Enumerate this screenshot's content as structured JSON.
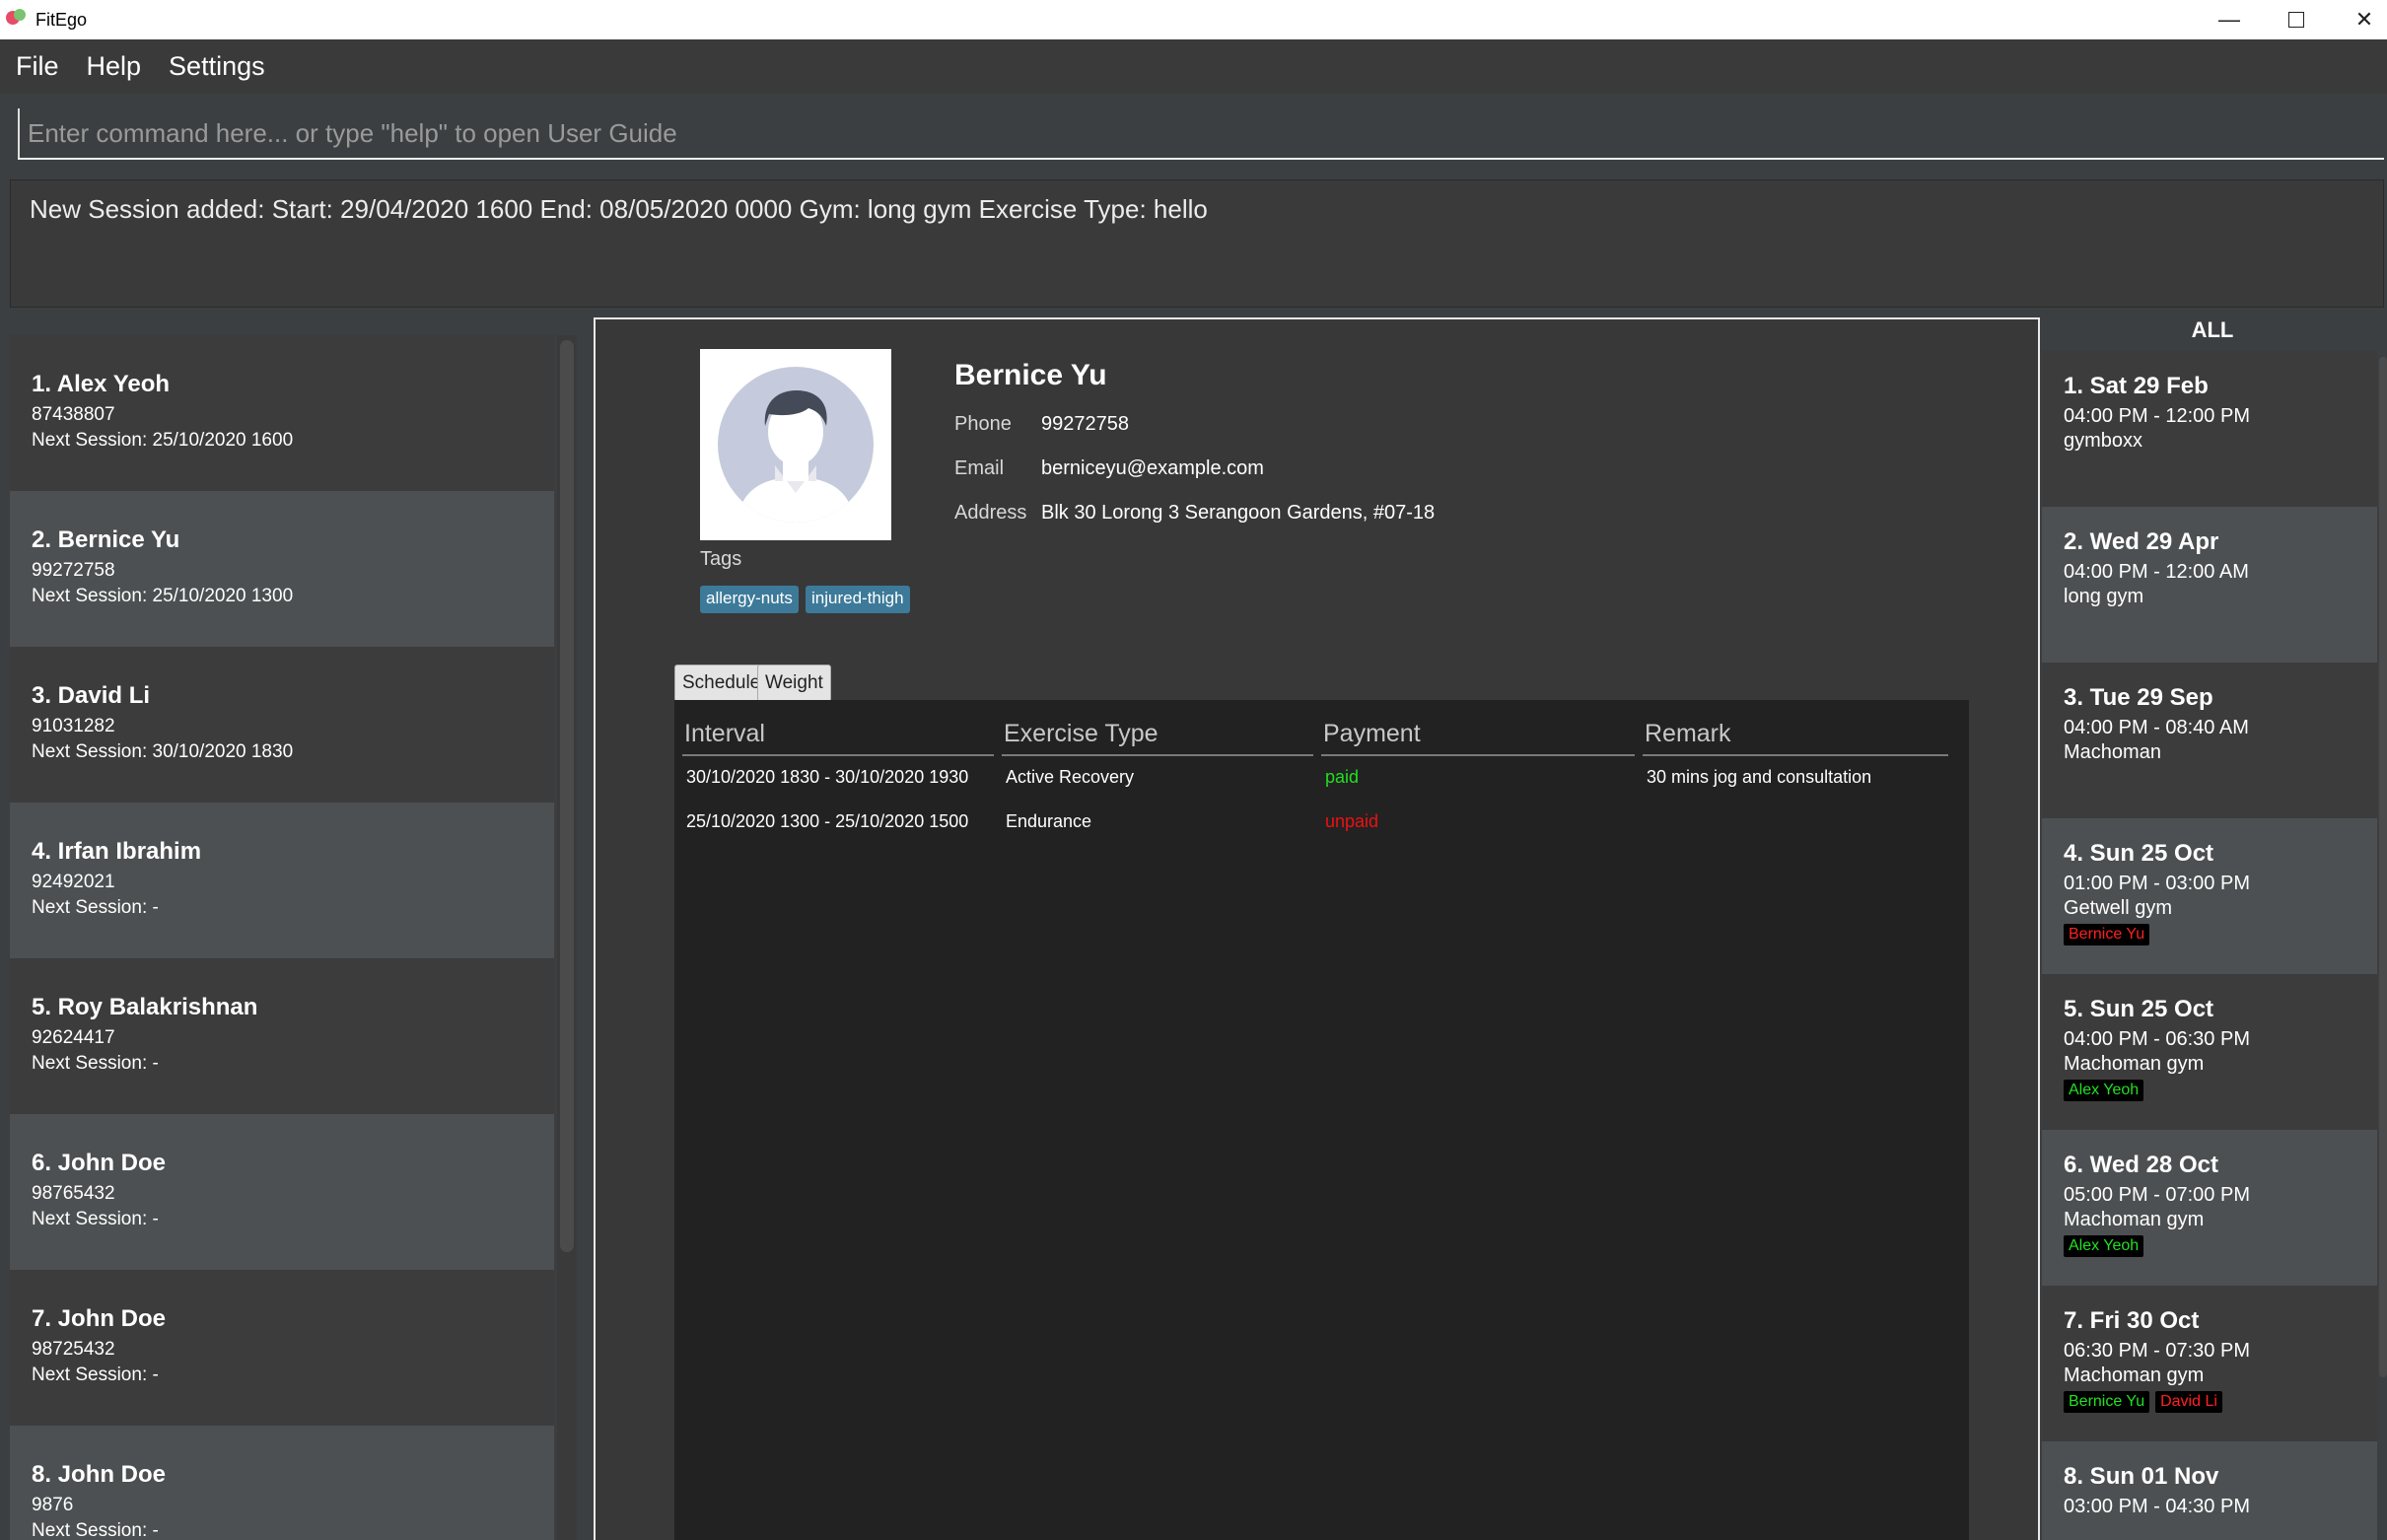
{
  "window": {
    "title": "FitEgo",
    "controls": {
      "minimize": "—",
      "close": "✕"
    }
  },
  "menu": [
    "File",
    "Help",
    "Settings"
  ],
  "command_box": {
    "placeholder": "Enter command here... or type \"help\" to open User Guide",
    "value": ""
  },
  "result": "New Session added:  Start: 29/04/2020 1600 End: 08/05/2020 0000 Gym: long gym Exercise Type: hello",
  "clients": [
    {
      "index": "1.",
      "name": "Alex Yeoh",
      "phone": "87438807",
      "next": "Next Session: 25/10/2020 1600"
    },
    {
      "index": "2.",
      "name": "Bernice Yu",
      "phone": "99272758",
      "next": "Next Session: 25/10/2020 1300"
    },
    {
      "index": "3.",
      "name": "David Li",
      "phone": "91031282",
      "next": "Next Session: 30/10/2020 1830"
    },
    {
      "index": "4.",
      "name": "Irfan Ibrahim",
      "phone": "92492021",
      "next": "Next Session:  -"
    },
    {
      "index": "5.",
      "name": "Roy Balakrishnan",
      "phone": "92624417",
      "next": "Next Session:  -"
    },
    {
      "index": "6.",
      "name": "John Doe",
      "phone": "98765432",
      "next": "Next Session:  -"
    },
    {
      "index": "7.",
      "name": "John Doe",
      "phone": "98725432",
      "next": "Next Session:  -"
    },
    {
      "index": "8.",
      "name": "John Doe",
      "phone": "9876",
      "next": "Next Session:  -"
    }
  ],
  "detail": {
    "name": "Bernice Yu",
    "phone_label": "Phone",
    "phone": "99272758",
    "email_label": "Email",
    "email": "berniceyu@example.com",
    "address_label": "Address",
    "address": "Blk 30 Lorong 3 Serangoon Gardens, #07-18",
    "tags_label": "Tags",
    "tags": [
      "allergy-nuts",
      "injured-thigh"
    ],
    "tabs": [
      "Schedule",
      "Weight"
    ],
    "table": {
      "headers": [
        "Interval",
        "Exercise Type",
        "Payment",
        "Remark"
      ],
      "rows": [
        {
          "interval": "30/10/2020 1830 - 30/10/2020 1930",
          "type": "Active Recovery",
          "payment": "paid",
          "remark": "30 mins jog and consultation"
        },
        {
          "interval": "25/10/2020 1300 - 25/10/2020 1500",
          "type": "Endurance",
          "payment": "unpaid",
          "remark": ""
        }
      ]
    }
  },
  "schedule": {
    "header": "ALL",
    "items": [
      {
        "index": "1.",
        "date": "Sat 29 Feb",
        "time": "04:00 PM - 12:00 PM",
        "gym": "gymboxx",
        "clients": []
      },
      {
        "index": "2.",
        "date": "Wed 29 Apr",
        "time": "04:00 PM - 12:00 AM",
        "gym": "long gym",
        "clients": []
      },
      {
        "index": "3.",
        "date": "Tue 29 Sep",
        "time": "04:00 PM - 08:40 AM",
        "gym": "Machoman",
        "clients": []
      },
      {
        "index": "4.",
        "date": "Sun 25 Oct",
        "time": "01:00 PM - 03:00 PM",
        "gym": "Getwell gym",
        "clients": [
          {
            "name": "Bernice Yu",
            "color": "#ff2020"
          }
        ]
      },
      {
        "index": "5.",
        "date": "Sun 25 Oct",
        "time": "04:00 PM - 06:30 PM",
        "gym": "Machoman gym",
        "clients": [
          {
            "name": "Alex Yeoh",
            "color": "#22e022"
          }
        ]
      },
      {
        "index": "6.",
        "date": "Wed 28 Oct",
        "time": "05:00 PM - 07:00 PM",
        "gym": "Machoman gym",
        "clients": [
          {
            "name": "Alex Yeoh",
            "color": "#22e022"
          }
        ]
      },
      {
        "index": "7.",
        "date": "Fri 30 Oct",
        "time": "06:30 PM - 07:30 PM",
        "gym": "Machoman gym",
        "clients": [
          {
            "name": "Bernice Yu",
            "color": "#22e022"
          },
          {
            "name": "David Li",
            "color": "#ff2020"
          }
        ]
      },
      {
        "index": "8.",
        "date": "Sun 01 Nov",
        "time": "03:00 PM - 04:30 PM",
        "gym": "",
        "clients": []
      }
    ]
  },
  "colors": {
    "paid": "#22dd22",
    "unpaid": "#ee1111",
    "tag_bg": "#3d7a99"
  }
}
